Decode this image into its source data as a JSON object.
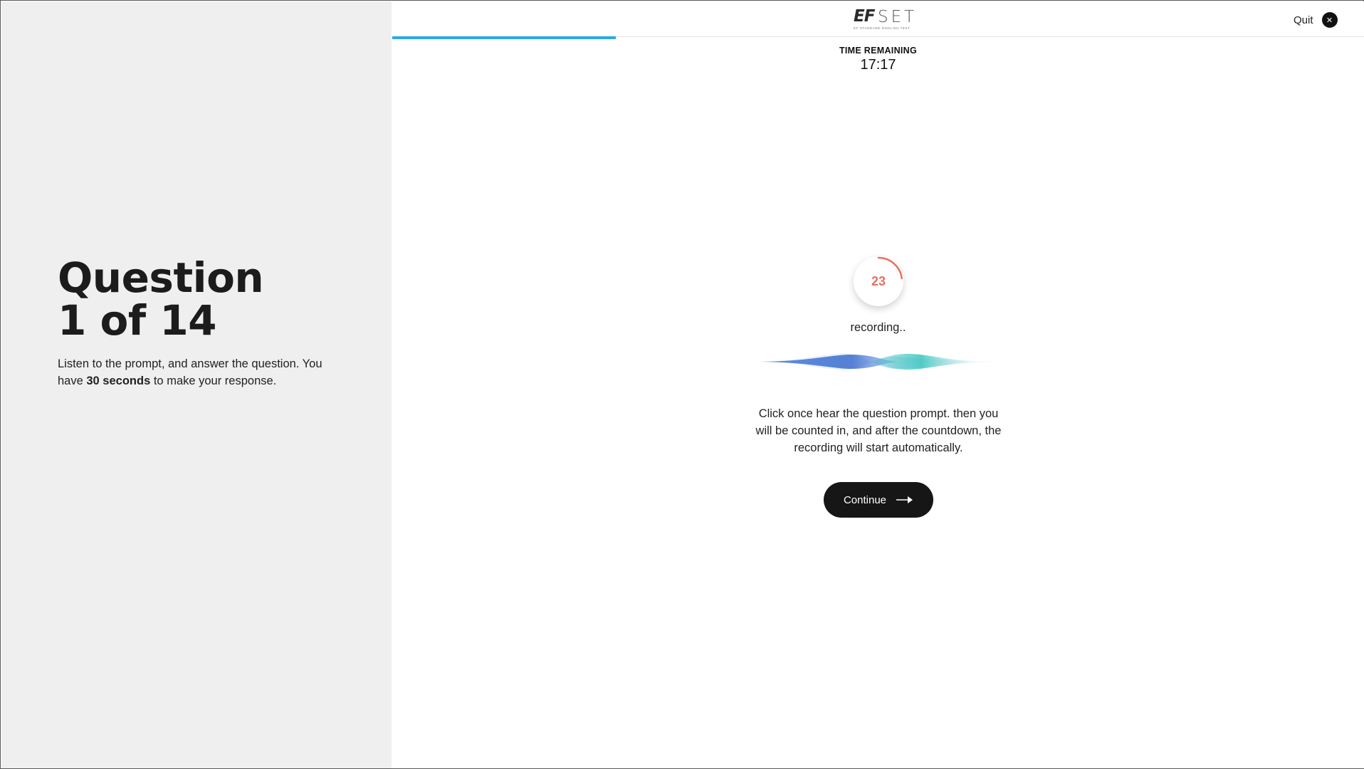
{
  "sidebar": {
    "title_line1": "Question",
    "title_line2": "1 of 14",
    "desc_before": "Listen to the prompt, and answer the question. You have ",
    "desc_bold": "30 seconds",
    "desc_after": " to make your response."
  },
  "header": {
    "logo_ef": "EF",
    "logo_set": "SET",
    "logo_tagline": "EF STANDARD ENGLISH TEST",
    "quit_label": "Quit",
    "quit_icon": "close-icon",
    "progress_fraction": 0.23
  },
  "timer": {
    "label": "TIME REMAINING",
    "value": "17:17"
  },
  "recorder": {
    "countdown": "23",
    "countdown_fraction": 0.23,
    "status": "recording..",
    "wave_icon": "waveform-icon"
  },
  "instructions": "Click once hear the question prompt. then you will be counted in, and after the countdown, the recording will start automatically.",
  "continue_button": {
    "label": "Continue",
    "icon": "arrow-right-icon"
  },
  "colors": {
    "accent_progress": "#2aa8e6",
    "countdown_red": "#e8705d",
    "button_dark": "#161616",
    "sidebar_bg": "#efefef"
  }
}
